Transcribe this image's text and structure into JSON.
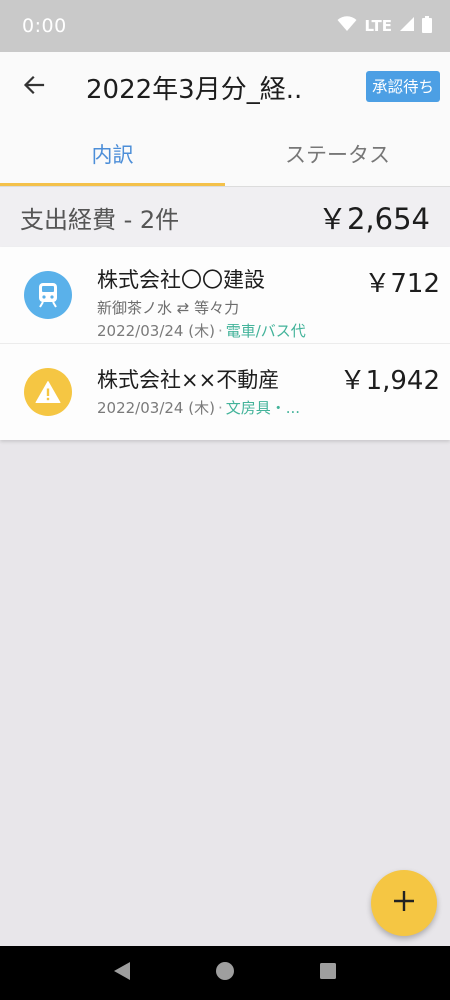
{
  "status_bar": {
    "time": "0:00",
    "network": "LTE"
  },
  "header": {
    "title": "2022年3月分_経..",
    "status_badge": "承認待ち"
  },
  "tabs": [
    {
      "label": "内訳",
      "active": true
    },
    {
      "label": "ステータス",
      "active": false
    }
  ],
  "summary": {
    "label": "支出経費 - 2件",
    "total": "￥2,654"
  },
  "expenses": [
    {
      "company": "株式会社〇〇建設",
      "route": "新御茶ノ水 ⇄ 等々力",
      "date": "2022/03/24 (木)",
      "separator": "·",
      "category": "電車/バス代",
      "amount": "￥712",
      "icon": "train-icon",
      "icon_color": "#5ab1ea"
    },
    {
      "company": "株式会社××不動産",
      "date": "2022/03/24 (木)",
      "separator": "·",
      "category": "文房具・...",
      "amount": "￥1,942",
      "icon": "warning-icon",
      "icon_color": "#f5c643"
    }
  ],
  "colors": {
    "accent": "#4c8ed8",
    "tab_indicator": "#f4c14a",
    "category": "#43b39a",
    "fab": "#f5c643"
  }
}
